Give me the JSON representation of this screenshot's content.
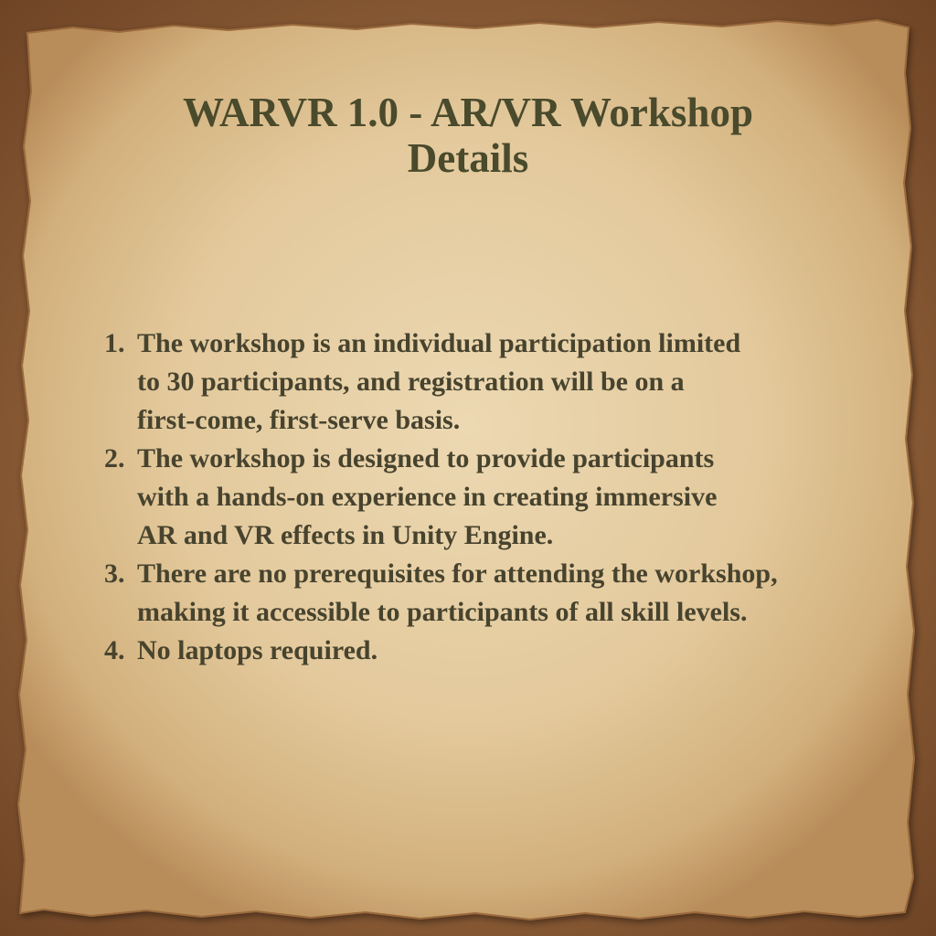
{
  "colors": {
    "background": "#8f5f38",
    "parchment": "#e8d2a8",
    "text": "#47432e"
  },
  "document": {
    "title_lines": [
      "WARVR 1.0 - AR/VR Workshop",
      "Details"
    ],
    "items": [
      {
        "number": "1.",
        "lines": [
          "The workshop is an individual participation limited",
          "to 30 participants, and registration will be on a",
          "first-come, first-serve basis."
        ]
      },
      {
        "number": "2.",
        "lines": [
          "The workshop is designed to provide participants",
          "with a hands-on experience in creating immersive",
          "AR and VR effects in Unity Engine."
        ]
      },
      {
        "number": "3.",
        "lines": [
          "There are no prerequisites for attending the workshop,",
          "making it accessible to participants of all skill levels."
        ]
      },
      {
        "number": "4.",
        "lines": [
          "No laptops required."
        ]
      }
    ]
  }
}
